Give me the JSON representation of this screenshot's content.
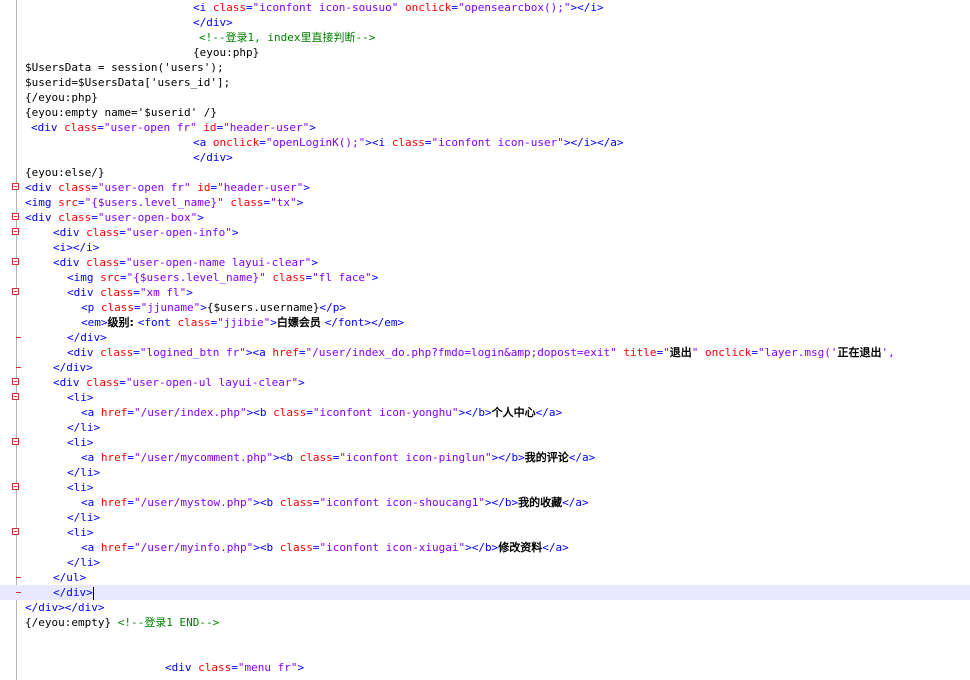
{
  "colors": {
    "tag": "#0000ff",
    "attribute": "#ff0000",
    "string": "#8000ff",
    "comment": "#008000",
    "text": "#000000",
    "current_line": "#e8e8ff",
    "fold_marker": "#d43030"
  },
  "lines": [
    [
      [
        "t",
        "<i "
      ],
      [
        "a",
        "class"
      ],
      [
        "t",
        "="
      ],
      [
        "s",
        "\"iconfont icon-sousuo\""
      ],
      [
        "t",
        " "
      ],
      [
        "a",
        "onclick"
      ],
      [
        "t",
        "="
      ],
      [
        "s",
        "\"opensearcbox();\""
      ],
      [
        "t",
        "></i>"
      ]
    ],
    [
      [
        "t",
        "</div>"
      ]
    ],
    [
      [
        "c",
        "<!--登录1, index里直接判断-->"
      ]
    ],
    [
      [
        "x",
        "{eyou:php}"
      ]
    ],
    [
      [
        "x",
        "$UsersData = session('users');"
      ]
    ],
    [
      [
        "x",
        "$userid=$UsersData['users_id'];"
      ]
    ],
    [
      [
        "x",
        "{/eyou:php}"
      ]
    ],
    [
      [
        "x",
        "{eyou:empty name='$userid' /}"
      ]
    ],
    [
      [
        "t",
        "<div "
      ],
      [
        "a",
        "class"
      ],
      [
        "t",
        "="
      ],
      [
        "s",
        "\"user-open fr\""
      ],
      [
        "t",
        " "
      ],
      [
        "a",
        "id"
      ],
      [
        "t",
        "="
      ],
      [
        "s",
        "\"header-user\""
      ],
      [
        "t",
        ">"
      ]
    ],
    [
      [
        "t",
        "<a "
      ],
      [
        "a",
        "onclick"
      ],
      [
        "t",
        "="
      ],
      [
        "s",
        "\"openLoginK();\""
      ],
      [
        "t",
        "><i "
      ],
      [
        "a",
        "class"
      ],
      [
        "t",
        "="
      ],
      [
        "s",
        "\"iconfont icon-user\""
      ],
      [
        "t",
        "></i></a>"
      ]
    ],
    [
      [
        "t",
        "</div>"
      ]
    ],
    [
      [
        "x",
        "{eyou:else/}"
      ]
    ],
    [
      [
        "t",
        "<div "
      ],
      [
        "a",
        "class"
      ],
      [
        "t",
        "="
      ],
      [
        "s",
        "\"user-open fr\""
      ],
      [
        "t",
        " "
      ],
      [
        "a",
        "id"
      ],
      [
        "t",
        "="
      ],
      [
        "s",
        "\"header-user\""
      ],
      [
        "t",
        ">"
      ]
    ],
    [
      [
        "t",
        "<img "
      ],
      [
        "a",
        "src"
      ],
      [
        "t",
        "="
      ],
      [
        "s",
        "\"{$users.level_name}\""
      ],
      [
        "t",
        " "
      ],
      [
        "a",
        "class"
      ],
      [
        "t",
        "="
      ],
      [
        "s",
        "\"tx\""
      ],
      [
        "t",
        ">"
      ]
    ],
    [
      [
        "t",
        "<div "
      ],
      [
        "a",
        "class"
      ],
      [
        "t",
        "="
      ],
      [
        "s",
        "\"user-open-box\""
      ],
      [
        "t",
        ">"
      ]
    ],
    [
      [
        "t",
        "<div "
      ],
      [
        "a",
        "class"
      ],
      [
        "t",
        "="
      ],
      [
        "s",
        "\"user-open-info\""
      ],
      [
        "t",
        ">"
      ]
    ],
    [
      [
        "t",
        "<i></i>"
      ]
    ],
    [
      [
        "t",
        "<div "
      ],
      [
        "a",
        "class"
      ],
      [
        "t",
        "="
      ],
      [
        "s",
        "\"user-open-name layui-clear\""
      ],
      [
        "t",
        ">"
      ]
    ],
    [
      [
        "t",
        "<img "
      ],
      [
        "a",
        "src"
      ],
      [
        "t",
        "="
      ],
      [
        "s",
        "\"{$users.level_name}\""
      ],
      [
        "t",
        " "
      ],
      [
        "a",
        "class"
      ],
      [
        "t",
        "="
      ],
      [
        "s",
        "\"fl face\""
      ],
      [
        "t",
        ">"
      ]
    ],
    [
      [
        "t",
        "<div "
      ],
      [
        "a",
        "class"
      ],
      [
        "t",
        "="
      ],
      [
        "s",
        "\"xm fl\""
      ],
      [
        "t",
        ">"
      ]
    ],
    [
      [
        "t",
        "<p "
      ],
      [
        "a",
        "class"
      ],
      [
        "t",
        "="
      ],
      [
        "s",
        "\"jjuname\""
      ],
      [
        "t",
        ">"
      ],
      [
        "x",
        "{$users.username}"
      ],
      [
        "t",
        "</p>"
      ]
    ],
    [
      [
        "t",
        "<em>"
      ],
      [
        "z",
        "级别: "
      ],
      [
        "t",
        "<font "
      ],
      [
        "a",
        "class"
      ],
      [
        "t",
        "="
      ],
      [
        "s",
        "\"jjibie\""
      ],
      [
        "t",
        ">"
      ],
      [
        "z",
        "白嫖会员 "
      ],
      [
        "t",
        "</font></em>"
      ]
    ],
    [
      [
        "t",
        "</div>"
      ]
    ],
    [
      [
        "t",
        "<div "
      ],
      [
        "a",
        "class"
      ],
      [
        "t",
        "="
      ],
      [
        "s",
        "\"logined_btn fr\""
      ],
      [
        "t",
        "><a "
      ],
      [
        "a",
        "href"
      ],
      [
        "t",
        "="
      ],
      [
        "s",
        "\"/user/index_do.php?fmdo=login&amp;dopost=exit\""
      ],
      [
        "t",
        " "
      ],
      [
        "a",
        "title"
      ],
      [
        "t",
        "="
      ],
      [
        "s",
        "\""
      ],
      [
        "z",
        "退出"
      ],
      [
        "s",
        "\""
      ],
      [
        "t",
        " "
      ],
      [
        "a",
        "onclick"
      ],
      [
        "t",
        "="
      ],
      [
        "s",
        "\"layer.msg('"
      ],
      [
        "z",
        "正在退出"
      ],
      [
        "s",
        "',"
      ]
    ],
    [
      [
        "t",
        "</div>"
      ]
    ],
    [
      [
        "t",
        "<div "
      ],
      [
        "a",
        "class"
      ],
      [
        "t",
        "="
      ],
      [
        "s",
        "\"user-open-ul layui-clear\""
      ],
      [
        "t",
        ">"
      ]
    ],
    [
      [
        "t",
        "<li>"
      ]
    ],
    [
      [
        "t",
        "<a "
      ],
      [
        "a",
        "href"
      ],
      [
        "t",
        "="
      ],
      [
        "s",
        "\"/user/index.php\""
      ],
      [
        "t",
        "><b "
      ],
      [
        "a",
        "class"
      ],
      [
        "t",
        "="
      ],
      [
        "s",
        "\"iconfont icon-yonghu\""
      ],
      [
        "t",
        "></b>"
      ],
      [
        "z",
        "个人中心"
      ],
      [
        "t",
        "</a>"
      ]
    ],
    [
      [
        "t",
        "</li>"
      ]
    ],
    [
      [
        "t",
        "<li>"
      ]
    ],
    [
      [
        "t",
        "<a "
      ],
      [
        "a",
        "href"
      ],
      [
        "t",
        "="
      ],
      [
        "s",
        "\"/user/mycomment.php\""
      ],
      [
        "t",
        "><b "
      ],
      [
        "a",
        "class"
      ],
      [
        "t",
        "="
      ],
      [
        "s",
        "\"iconfont icon-pinglun\""
      ],
      [
        "t",
        "></b>"
      ],
      [
        "z",
        "我的评论"
      ],
      [
        "t",
        "</a>"
      ]
    ],
    [
      [
        "t",
        "</li>"
      ]
    ],
    [
      [
        "t",
        "<li>"
      ]
    ],
    [
      [
        "t",
        "<a "
      ],
      [
        "a",
        "href"
      ],
      [
        "t",
        "="
      ],
      [
        "s",
        "\"/user/mystow.php\""
      ],
      [
        "t",
        "><b "
      ],
      [
        "a",
        "class"
      ],
      [
        "t",
        "="
      ],
      [
        "s",
        "\"iconfont icon-shoucang1\""
      ],
      [
        "t",
        "></b>"
      ],
      [
        "z",
        "我的收藏"
      ],
      [
        "t",
        "</a>"
      ]
    ],
    [
      [
        "t",
        "</li>"
      ]
    ],
    [
      [
        "t",
        "<li>"
      ]
    ],
    [
      [
        "t",
        "<a "
      ],
      [
        "a",
        "href"
      ],
      [
        "t",
        "="
      ],
      [
        "s",
        "\"/user/myinfo.php\""
      ],
      [
        "t",
        "><b "
      ],
      [
        "a",
        "class"
      ],
      [
        "t",
        "="
      ],
      [
        "s",
        "\"iconfont icon-xiugai\""
      ],
      [
        "t",
        "></b>"
      ],
      [
        "z",
        "修改资料"
      ],
      [
        "t",
        "</a>"
      ]
    ],
    [
      [
        "t",
        "</li>"
      ]
    ],
    [
      [
        "t",
        "</ul>"
      ]
    ],
    [
      [
        "t",
        "</div>"
      ]
    ],
    [
      [
        "t",
        "</div></div>"
      ]
    ],
    [
      [
        "x",
        "{/eyou:empty} "
      ],
      [
        "c",
        "<!--登录1 END-->"
      ]
    ],
    [],
    [],
    [
      [
        "t",
        "<div "
      ],
      [
        "a",
        "class"
      ],
      [
        "t",
        "="
      ],
      [
        "s",
        "\"menu fr\""
      ],
      [
        "t",
        ">"
      ]
    ]
  ]
}
